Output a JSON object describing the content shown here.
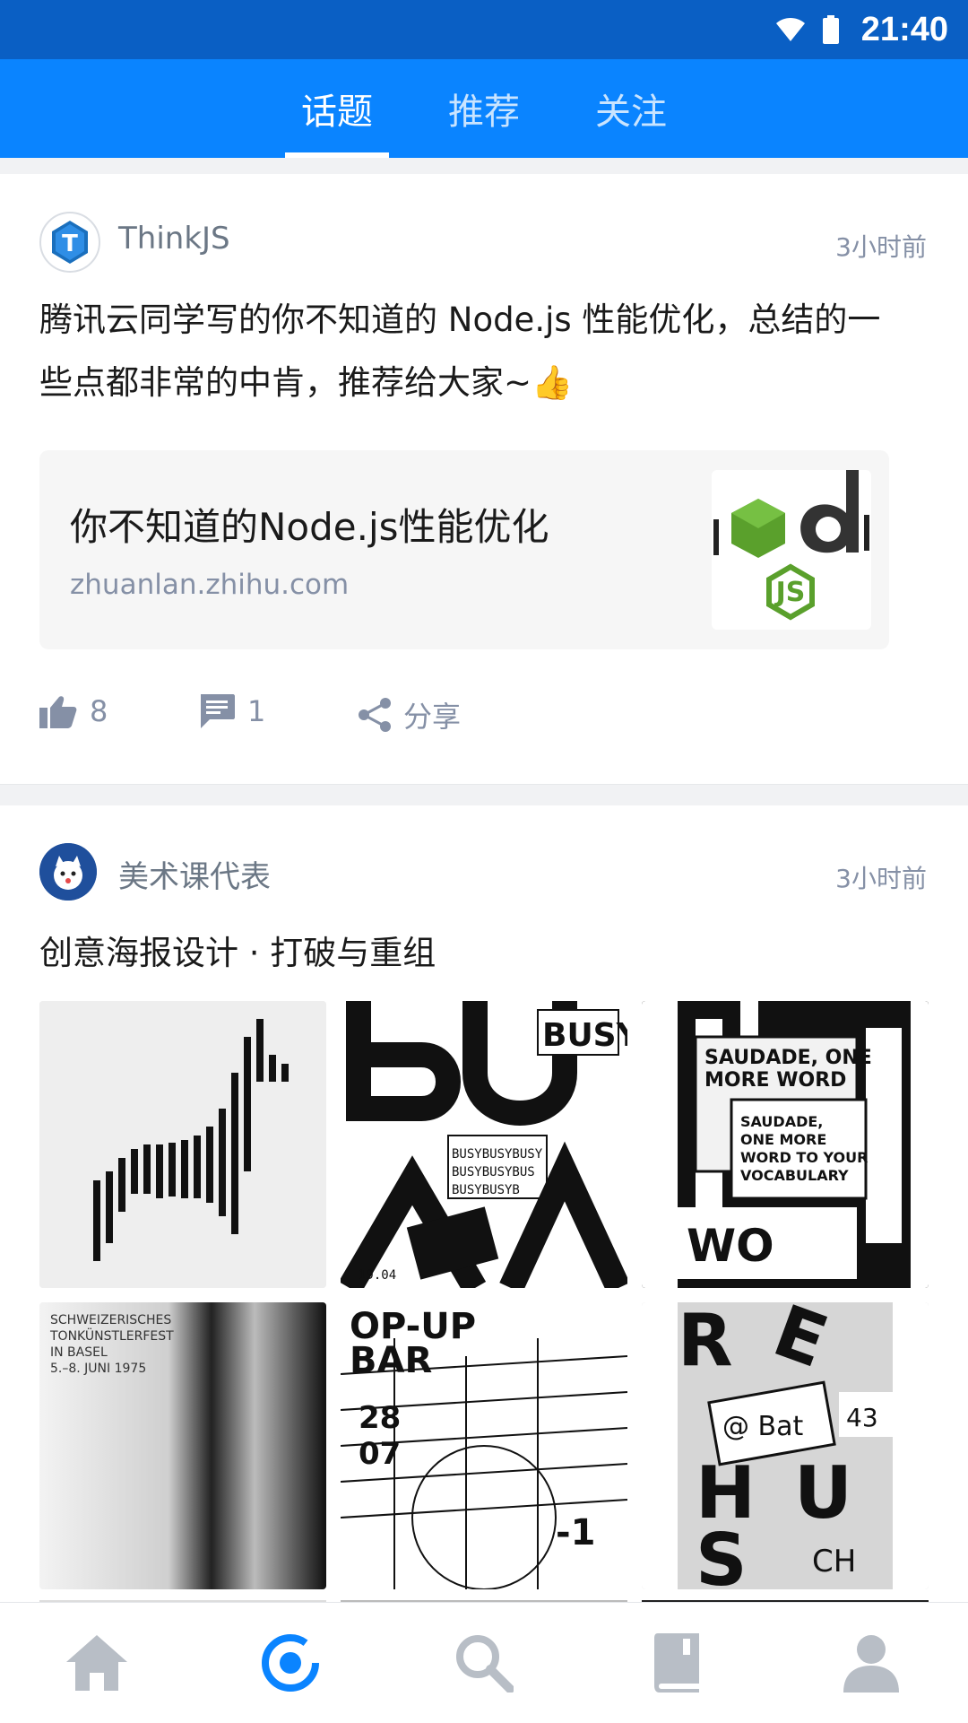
{
  "status_bar": {
    "time": "21:40",
    "icons": [
      "wifi-icon",
      "battery-icon"
    ]
  },
  "top_tabs": [
    {
      "label": "话题",
      "active": true
    },
    {
      "label": "推荐",
      "active": false
    },
    {
      "label": "关注",
      "active": false
    }
  ],
  "posts": [
    {
      "author": "ThinkJS",
      "avatar_letter": "T",
      "time": "3小时前",
      "text_line1": "腾讯云同学写的你不知道的 Node.js 性能优化，总结的一",
      "text_line2": "些点都非常的中肯，推荐给大家~👍",
      "link": {
        "title": "你不知道的Node.js性能优化",
        "host": "zhuanlan.zhihu.com"
      },
      "actions": {
        "likes": "8",
        "comments": "1",
        "share_label": "分享"
      }
    },
    {
      "author": "美术课代表",
      "time": "3小时前",
      "text": "创意海报设计 · 打破与重组",
      "images": [
        "deer-poster",
        "busy-poster",
        "saudade-poster",
        "tonkunstlerfest-poster",
        "pop-up-bar-poster",
        "red-bat-poster"
      ]
    }
  ],
  "bottom_nav": [
    {
      "name": "home-icon",
      "active": false
    },
    {
      "name": "discover-icon",
      "active": true
    },
    {
      "name": "search-icon",
      "active": false
    },
    {
      "name": "book-icon",
      "active": false
    },
    {
      "name": "profile-icon",
      "active": false
    }
  ],
  "colors": {
    "primary": "#0a84ff",
    "status_bar": "#0a5fc4",
    "muted": "#8590a6"
  }
}
